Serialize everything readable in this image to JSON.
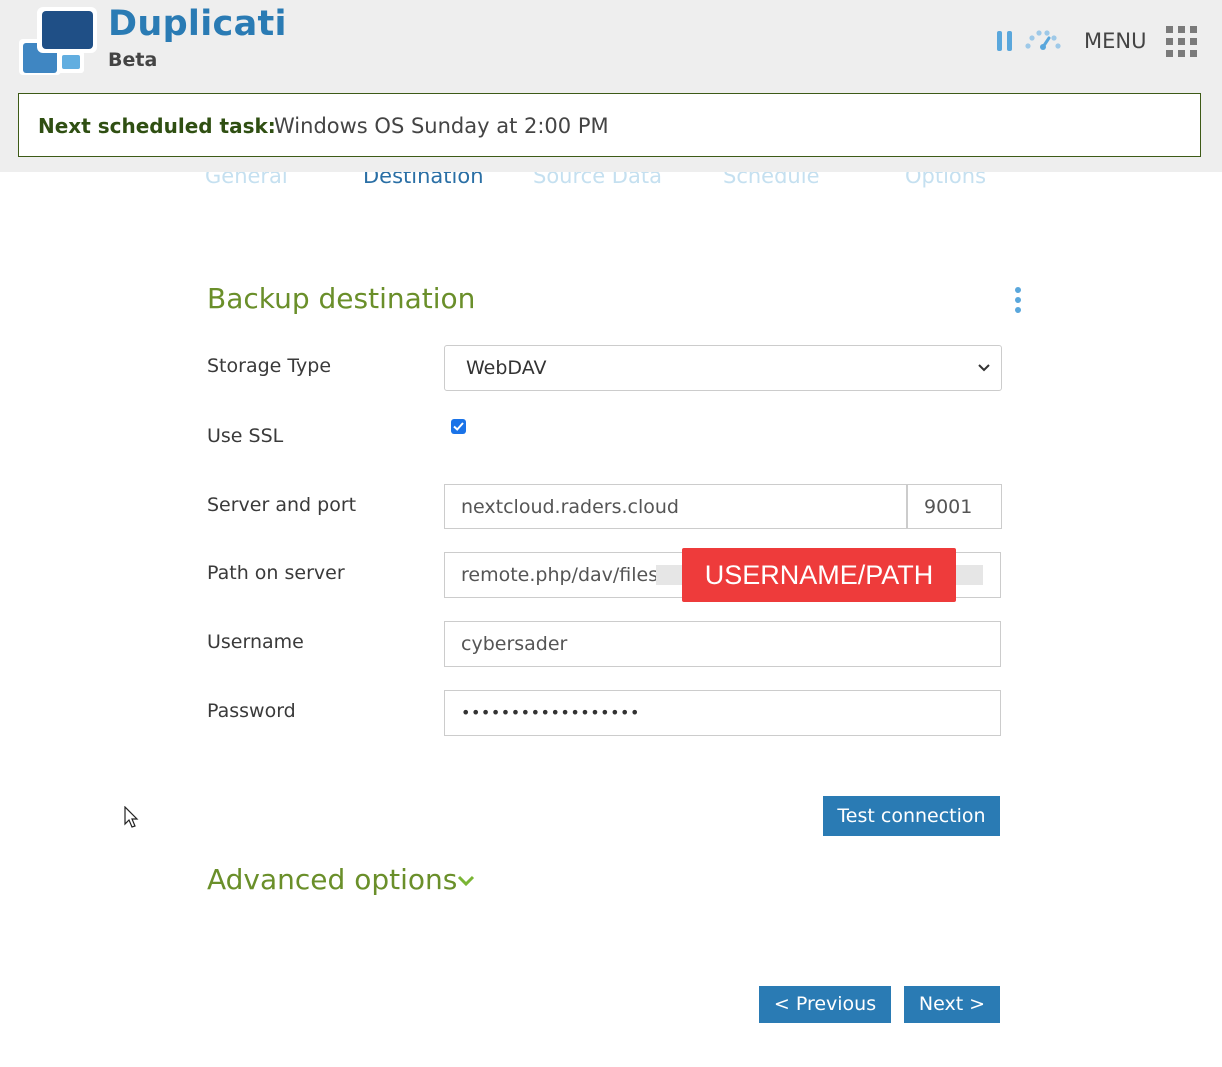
{
  "app": {
    "title": "Duplicati",
    "subtitle": "Beta",
    "menu_label": "MENU"
  },
  "notice": {
    "label": "Next scheduled task:",
    "value": "Windows OS Sunday at 2:00 PM"
  },
  "tabs": [
    {
      "label": "General",
      "active": false
    },
    {
      "label": "Destination",
      "active": true
    },
    {
      "label": "Source Data",
      "active": false
    },
    {
      "label": "Schedule",
      "active": false
    },
    {
      "label": "Options",
      "active": false
    }
  ],
  "form": {
    "section_title": "Backup destination",
    "storage_type": {
      "label": "Storage Type",
      "value": "WebDAV"
    },
    "use_ssl": {
      "label": "Use SSL",
      "checked": true
    },
    "server": {
      "label": "Server and port",
      "host": "nextcloud.raders.cloud",
      "port": "9001"
    },
    "path": {
      "label": "Path on server",
      "value": "remote.php/dav/files/",
      "redaction": "USERNAME/PATH"
    },
    "username": {
      "label": "Username",
      "value": "cybersader"
    },
    "password": {
      "label": "Password",
      "value": "••••••••••••••••••"
    }
  },
  "buttons": {
    "test_connection": "Test connection",
    "previous": "< Previous",
    "next": "Next >"
  },
  "advanced": {
    "label": "Advanced options"
  },
  "colors": {
    "brand_blue": "#2a7bb4",
    "section_green": "#6a8f2a",
    "redaction_red": "#ee3b3b"
  },
  "icons": [
    "duplicati-logo",
    "pause-icon",
    "throttle-icon",
    "apps-grid-icon",
    "kebab-menu-icon",
    "chevron-down-icon",
    "mouse-cursor-icon"
  ]
}
